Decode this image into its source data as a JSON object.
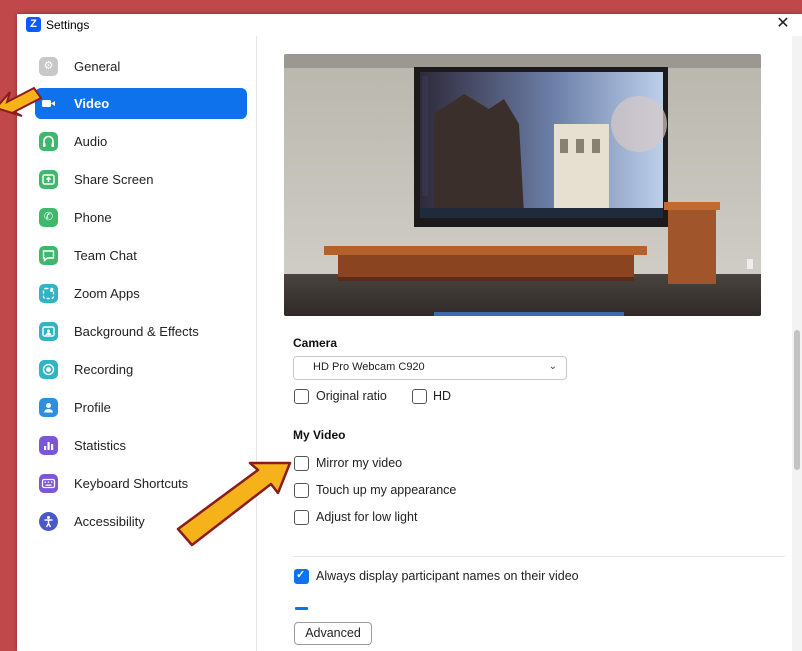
{
  "window": {
    "title": "Settings",
    "logo_letter": "Z"
  },
  "sidebar": {
    "items": [
      {
        "label": "General",
        "icon": "gear-icon",
        "color": "#c8c8c8"
      },
      {
        "label": "Video",
        "icon": "video-camera-icon",
        "color": "#0e72ed",
        "active": true
      },
      {
        "label": "Audio",
        "icon": "headphones-icon",
        "color": "#3fb86d"
      },
      {
        "label": "Share Screen",
        "icon": "share-screen-icon",
        "color": "#3fb86d"
      },
      {
        "label": "Phone",
        "icon": "phone-icon",
        "color": "#3fb86d"
      },
      {
        "label": "Team Chat",
        "icon": "chat-icon",
        "color": "#3fb86d"
      },
      {
        "label": "Zoom Apps",
        "icon": "apps-icon",
        "color": "#2fb3c5"
      },
      {
        "label": "Background & Effects",
        "icon": "background-icon",
        "color": "#2fb3c5"
      },
      {
        "label": "Recording",
        "icon": "record-icon",
        "color": "#2fb3c5"
      },
      {
        "label": "Profile",
        "icon": "profile-icon",
        "color": "#2f8fdf"
      },
      {
        "label": "Statistics",
        "icon": "statistics-icon",
        "color": "#7b57d6"
      },
      {
        "label": "Keyboard Shortcuts",
        "icon": "keyboard-icon",
        "color": "#7b57d6"
      },
      {
        "label": "Accessibility",
        "icon": "accessibility-icon",
        "color": "#4a58c8"
      }
    ]
  },
  "camera": {
    "title": "Camera",
    "selected": "HD Pro Webcam C920",
    "original_ratio": {
      "label": "Original ratio",
      "checked": false
    },
    "hd": {
      "label": "HD",
      "checked": false
    }
  },
  "my_video": {
    "title": "My Video",
    "mirror": {
      "label": "Mirror my video",
      "checked": false
    },
    "touch_up": {
      "label": "Touch up my appearance",
      "checked": false
    },
    "low_light": {
      "label": "Adjust for low light",
      "checked": false
    }
  },
  "display_names": {
    "label": "Always display participant names on their video",
    "checked": true
  },
  "advanced_button": "Advanced",
  "colors": {
    "accent": "#0e72ed",
    "frame": "#c0484b",
    "arrow_fill": "#f6b21b",
    "arrow_stroke": "#8b1c1c"
  }
}
